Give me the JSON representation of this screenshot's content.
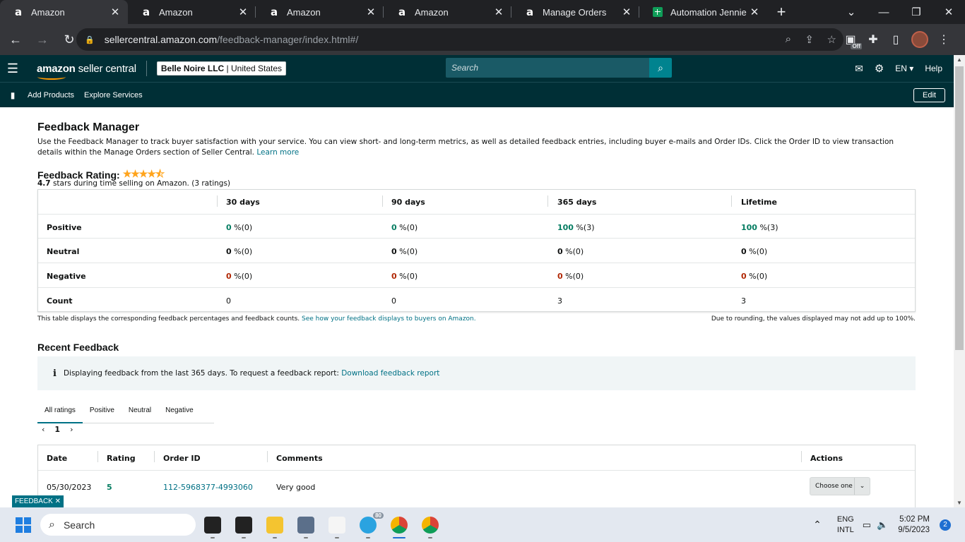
{
  "browser": {
    "tabs": [
      {
        "title": "Amazon",
        "favicon": "amazon-icon",
        "active": true
      },
      {
        "title": "Amazon",
        "favicon": "amazon-icon",
        "active": false
      },
      {
        "title": "Amazon",
        "favicon": "amazon-icon",
        "active": false
      },
      {
        "title": "Amazon",
        "favicon": "amazon-icon",
        "active": false
      },
      {
        "title": "Manage Orders",
        "favicon": "amazon-icon",
        "active": false
      },
      {
        "title": "Automation Jennie Mi",
        "favicon": "sheets-icon",
        "active": false
      }
    ],
    "url_host": "sellercentral.amazon.com",
    "url_path": "/feedback-manager/index.html#/",
    "extension_badge": "Off"
  },
  "sc_header": {
    "logo_brand": "amazon",
    "logo_suffix": " seller central",
    "account_name": "Belle Noire LLC",
    "account_region": " | United States",
    "search_placeholder": "Search",
    "language": "EN",
    "help": "Help"
  },
  "sc_subnav": {
    "links": [
      "Add Products",
      "Explore Services"
    ],
    "edit": "Edit"
  },
  "page": {
    "title": "Feedback Manager",
    "description": "Use the Feedback Manager to track buyer satisfaction with your service. You can view short- and long-term metrics, as well as detailed feedback entries, including buyer e-mails and Order IDs. Click the Order ID to view transaction details within the Manage Orders section of Seller Central.",
    "learn_more": "Learn more",
    "rating_label": "Feedback Rating:",
    "rating_stars": 4.7,
    "rating_value": "4.7",
    "rating_suffix": " stars during time selling on Amazon. (3 ratings)"
  },
  "feedback_table": {
    "columns": [
      "30 days",
      "90 days",
      "365 days",
      "Lifetime"
    ],
    "rows": [
      {
        "label": "Positive",
        "values": [
          "0",
          "0",
          "100",
          "100"
        ],
        "counts": [
          " %(0)",
          " %(0)",
          " %(3)",
          " %(3)"
        ]
      },
      {
        "label": "Neutral",
        "values": [
          "0",
          "0",
          "0",
          "0"
        ],
        "counts": [
          " %(0)",
          " %(0)",
          " %(0)",
          " %(0)"
        ]
      },
      {
        "label": "Negative",
        "values": [
          "0",
          "0",
          "0",
          "0"
        ],
        "counts": [
          " %(0)",
          " %(0)",
          " %(0)",
          " %(0)"
        ]
      },
      {
        "label": "Count",
        "values": [
          "0",
          "0",
          "3",
          "3"
        ]
      }
    ],
    "note": "This table displays the corresponding feedback percentages and feedback counts.",
    "note_link": "See how your feedback displays to buyers on Amazon.",
    "rounding_note": "Due to rounding, the values displayed may not add up to 100%."
  },
  "recent": {
    "title": "Recent Feedback",
    "info_text": "Displaying feedback from the last 365 days. To request a feedback report:",
    "info_link": "Download feedback report",
    "tabs": [
      "All ratings",
      "Positive",
      "Neutral",
      "Negative"
    ],
    "page": "1",
    "columns": [
      "Date",
      "Rating",
      "Order ID",
      "Comments",
      "Actions"
    ],
    "rows": [
      {
        "date": "05/30/2023",
        "rating": "5",
        "order_id": "112-5968377-4993060",
        "comment": "Very good",
        "action": "Choose one"
      }
    ]
  },
  "feedback_button": "FEEDBACK",
  "taskbar": {
    "search_placeholder": "Search",
    "telegram_badge": "80",
    "lang1": "ENG",
    "lang2": "INTL",
    "time": "5:02 PM",
    "date": "9/5/2023",
    "notifications": "2"
  },
  "colors": {
    "header_bg": "#002f36",
    "link": "#007185",
    "positive": "#067d62",
    "negative": "#b12704",
    "star": "#ffa41c"
  }
}
